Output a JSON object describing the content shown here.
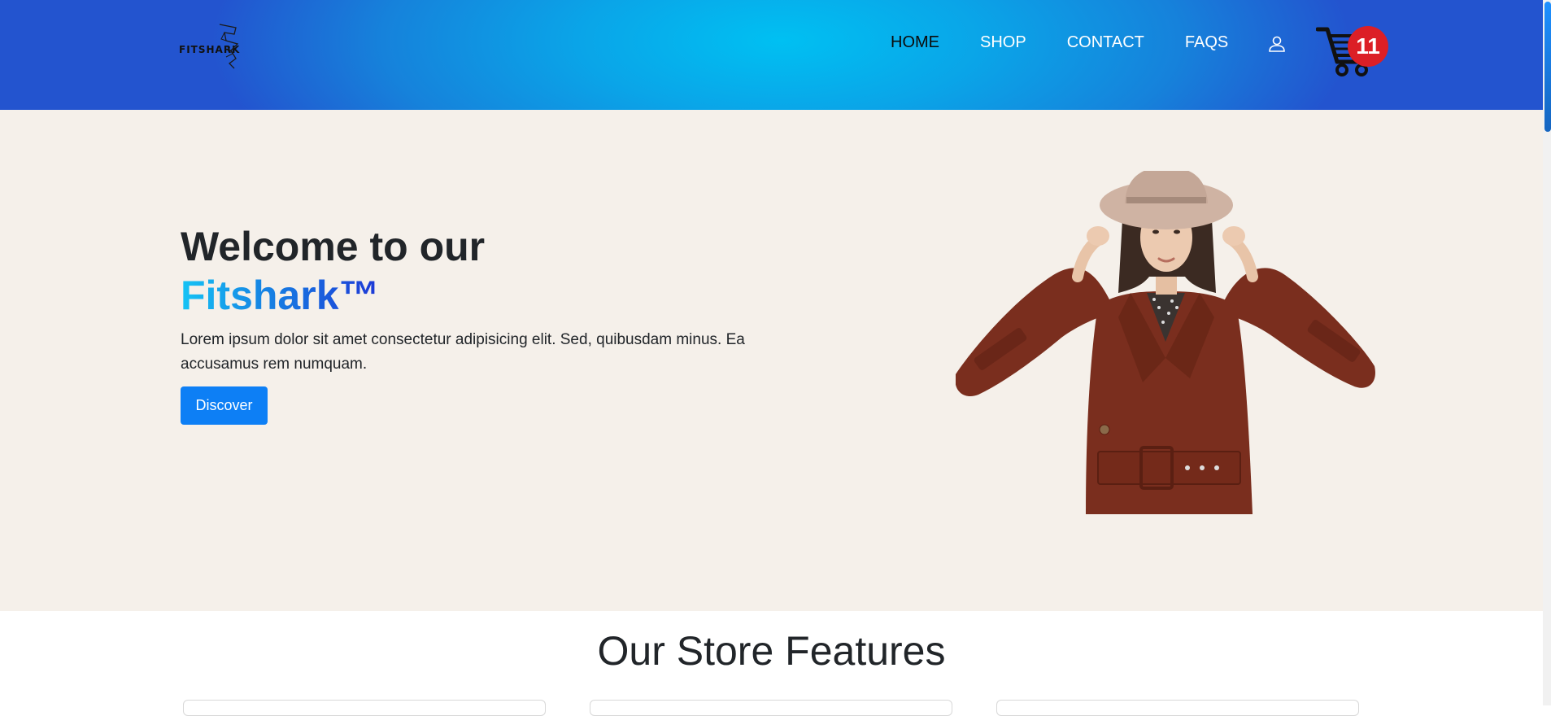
{
  "header": {
    "logo_text": "FITSHARK",
    "nav": [
      {
        "label": "HOME"
      },
      {
        "label": "SHOP"
      },
      {
        "label": "CONTACT"
      },
      {
        "label": "FAQS"
      }
    ],
    "cart_count": "11"
  },
  "hero": {
    "title_line1": "Welcome to our",
    "title_line2": "Fitshark™",
    "description": "Lorem ipsum dolor sit amet consectetur adipisicing elit. Sed, quibusdam minus. Ea accusamus rem numquam.",
    "button_label": "Discover"
  },
  "features": {
    "title": "Our Store Features"
  },
  "colors": {
    "header_center": "#00c0f2",
    "header_edge": "#2354cf",
    "hero_bg": "#f5f0ea",
    "button": "#0d7ff5",
    "badge": "#dc1f26",
    "coat": "#7a2e1e"
  },
  "icons": [
    "fitshark-logo-icon",
    "user-icon",
    "shopping-cart-icon"
  ]
}
